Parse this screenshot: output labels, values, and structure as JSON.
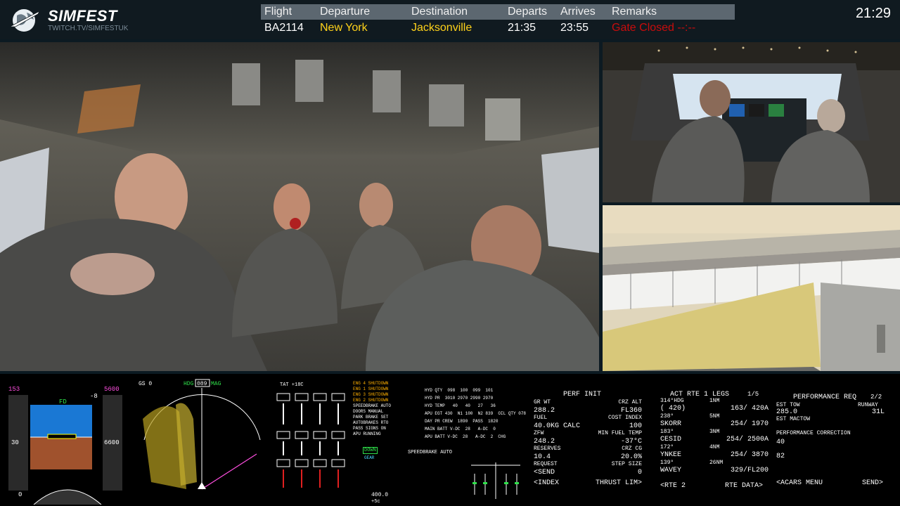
{
  "brand": {
    "name": "SIMFEST",
    "subtitle": "TWITCH.TV/SIMFESTUK"
  },
  "board": {
    "headers": {
      "flight": "Flight",
      "departure": "Departure",
      "destination": "Destination",
      "departs": "Departs",
      "arrives": "Arrives",
      "remarks": "Remarks"
    },
    "row": {
      "flight": "BA2114",
      "departure": "New York",
      "destination": "Jacksonville",
      "departs": "21:35",
      "arrives": "23:55",
      "remarks": "Gate Closed --:--"
    }
  },
  "clock": "21:29",
  "colors": {
    "accent_yellow": "#ffd21a",
    "alert_red": "#c80c0c",
    "header_bar": "#5c6770",
    "cdu_green": "#2fe04a"
  },
  "pfd": {
    "speed": "153",
    "alt": "5600",
    "fd": "FD",
    "vs": "-8",
    "baro": "30",
    "ias_box": "6600",
    "bottom_left": "0",
    "ba_left": "30"
  },
  "nd": {
    "hdg_label": "HDG",
    "hdg": "089",
    "mag": "MAG",
    "gs": "GS 0"
  },
  "eicas": {
    "tat": "TAT +18C",
    "msgs": [
      "ENG 4 SHUTDOWN",
      "ENG 1 SHUTDOWN",
      "ENG 3 SHUTDOWN",
      "ENG 2 SHUTDOWN",
      "SPEEDBRAKE AUTO",
      "DOORS MANUAL",
      "PARK BRAKE SET",
      "AUTOBRAKES RTO",
      "PASS SIGNS ON",
      "APU RUNNING"
    ],
    "gear": "DOWN",
    "gear2": "GEAR",
    "total_fuel": "400.0",
    "temp": "+5c"
  },
  "sys": {
    "rows": [
      "HYD QTY  098  100  099  101",
      "HYD PR  3010 2970 2990 2970",
      "HYD TEMP   40   40   27   36",
      "APU EGT 430  N1 100  N2 839  OIL QTY 078",
      "DAY PR CREW  1890  PASS  1820",
      "MAIN BATT V-DC  28   A-DC  0",
      "APU BATT V-DC  28   A-DC  2  CHG"
    ],
    "speedbrake": "SPEEDBRAKE AUTO"
  },
  "cdu1": {
    "title": "PERF INIT",
    "lines": [
      {
        "l": "GR WT",
        "r": "CRZ ALT"
      },
      {
        "l": "288.2",
        "r": "FL360"
      },
      {
        "l": "FUEL",
        "r": "COST INDEX"
      },
      {
        "l": "40.0KG CALC",
        "r": "100"
      },
      {
        "l": "ZFW",
        "r": "MIN FUEL TEMP"
      },
      {
        "l": "248.2",
        "r": "-37°C"
      },
      {
        "l": "RESERVES",
        "r": "CRZ CG"
      },
      {
        "l": "10.4",
        "r": "20.0%"
      },
      {
        "l": "REQUEST",
        "r": "STEP SIZE"
      },
      {
        "l": "<SEND",
        "r": "0"
      },
      {
        "l": "<INDEX",
        "r": "THRUST LIM>"
      }
    ]
  },
  "cdu2": {
    "title": "ACT RTE 1 LEGS",
    "page": "1/5",
    "legs": [
      {
        "hdg": "314°HDG",
        "dist": "1NM",
        "fix": "( 420)",
        "alt": "163/ 420A"
      },
      {
        "hdg": "238°",
        "dist": "5NM",
        "fix": "SKORR",
        "alt": "254/ 1970"
      },
      {
        "hdg": "183°",
        "dist": "3NM",
        "fix": "CESID",
        "alt": "254/ 2500A"
      },
      {
        "hdg": "172°",
        "dist": "4NM",
        "fix": "YNKEE",
        "alt": "254/ 3870"
      },
      {
        "hdg": "139°",
        "dist": "26NM",
        "fix": "WAVEY",
        "alt": "329/FL200"
      }
    ],
    "bottom_l": "<RTE 2",
    "bottom_r": "RTE DATA>"
  },
  "cdu3": {
    "title": "PERFORMANCE REQ",
    "page": "2/2",
    "est_tow_label": "EST TOW",
    "runway_label": "RUNWAY",
    "est_tow": "285.0",
    "runway": "31L",
    "est_mactow": "EST MACTOW",
    "correction": "PERFORMANCE CORRECTION",
    "v1": "40",
    "v2": "82",
    "bottom_l": "<ACARS MENU",
    "bottom_r": "SEND>"
  }
}
